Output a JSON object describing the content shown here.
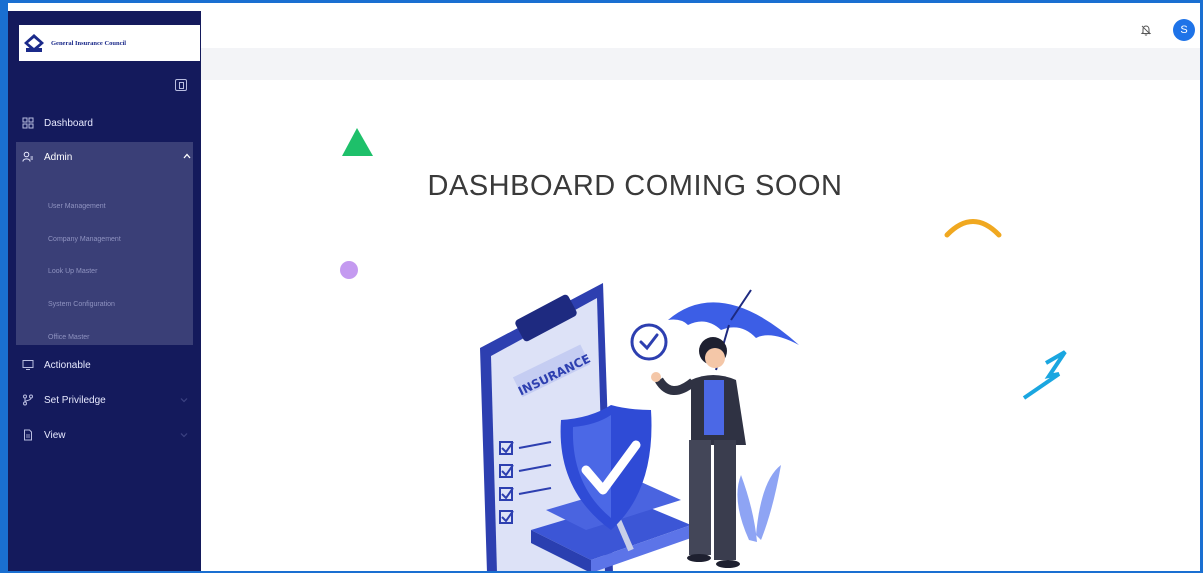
{
  "brand": {
    "name": "General Insurance Council",
    "colors": {
      "sidebar": "#141a5c",
      "sidebar_group": "#3a3f77",
      "accent": "#1e73e8"
    }
  },
  "sidebar": {
    "items": [
      {
        "label": "Dashboard",
        "icon": "grid-icon"
      },
      {
        "label": "Admin",
        "icon": "user-admin-icon",
        "expanded": true,
        "children": [
          {
            "label": "User Management"
          },
          {
            "label": "Company Management"
          },
          {
            "label": "Look Up Master"
          },
          {
            "label": "System Configuration"
          },
          {
            "label": "Office Master"
          }
        ]
      },
      {
        "label": "Actionable",
        "icon": "monitor-icon"
      },
      {
        "label": "Set Priviledge",
        "icon": "branch-icon"
      },
      {
        "label": "View",
        "icon": "document-icon"
      }
    ]
  },
  "header": {
    "avatar_initial": "S",
    "icons": [
      "bell-icon"
    ]
  },
  "main": {
    "headline": "DASHBOARD COMING SOON",
    "illustration_text": "INSURANCE"
  }
}
